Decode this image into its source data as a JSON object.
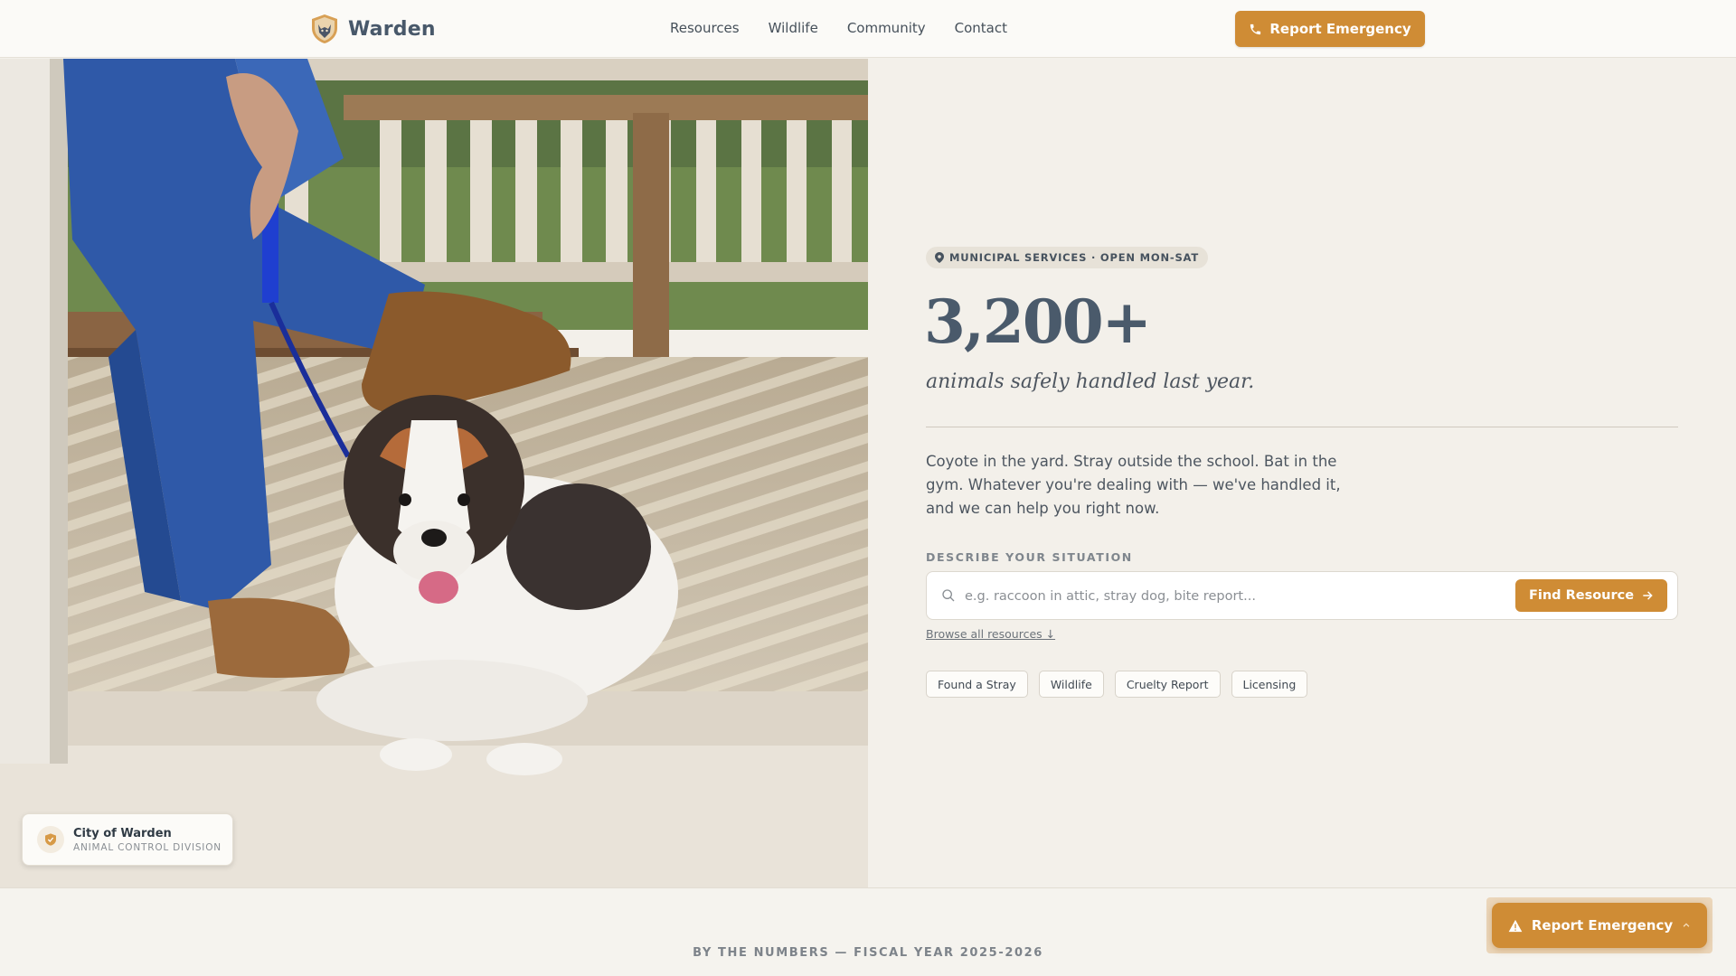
{
  "header": {
    "brand_name": "Warden",
    "nav": [
      "Resources",
      "Wildlife",
      "Community",
      "Contact"
    ],
    "emergency_label": "Report Emergency"
  },
  "hero_badge": {
    "title": "City of Warden",
    "subtitle": "ANIMAL CONTROL DIVISION"
  },
  "main": {
    "pill": "MUNICIPAL SERVICES · OPEN MON-SAT",
    "stat_number": "3,200+",
    "stat_caption": "animals safely handled last year.",
    "description": "Coyote in the yard. Stray outside the school. Bat in the gym. Whatever you're dealing with — we've handled it, and we can help you right now.",
    "situation_label": "DESCRIBE YOUR SITUATION",
    "search_placeholder": "e.g. raccoon in attic, stray dog, bite report...",
    "search_value": "",
    "find_label": "Find Resource",
    "browse_label": "Browse all resources ↓",
    "chips": [
      "Found a Stray",
      "Wildlife",
      "Cruelty Report",
      "Licensing"
    ]
  },
  "numbers_heading": "BY THE NUMBERS — FISCAL YEAR 2025-2026",
  "floating_button": {
    "label": "Report Emergency"
  },
  "colors": {
    "accent": "#cf8c35",
    "background": "#f3f0ea",
    "heading": "#4a5a6b"
  },
  "icons": [
    "shield-logo-icon",
    "phone-icon",
    "map-pin-icon",
    "search-icon",
    "arrow-right-icon",
    "shield-icon",
    "warning-icon",
    "chevron-up-icon"
  ]
}
